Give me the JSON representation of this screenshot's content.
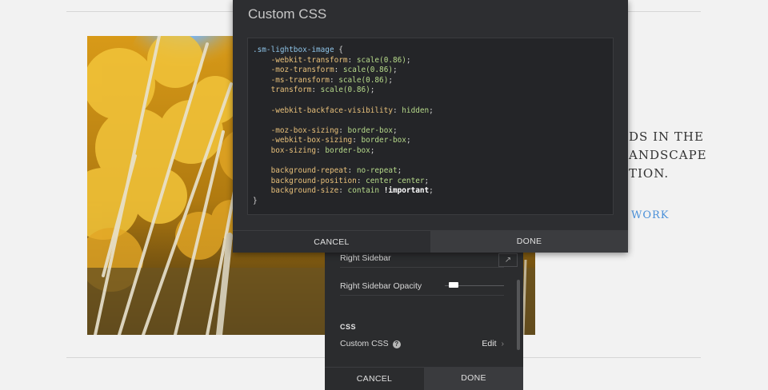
{
  "background_page": {
    "text_lines": [
      "DS IN THE",
      "ANDSCAPE",
      "TION."
    ],
    "link": "WORK"
  },
  "modal": {
    "title": "Custom CSS",
    "css_lines": [
      [
        {
          "t": ".sm-lightbox-image",
          "c": "sel"
        },
        {
          "t": " {",
          "c": ""
        }
      ],
      [
        {
          "t": "    -webkit-transform",
          "c": "prop"
        },
        {
          "t": ": ",
          "c": ""
        },
        {
          "t": "scale(0.86)",
          "c": "val"
        },
        {
          "t": ";",
          "c": ""
        }
      ],
      [
        {
          "t": "    -moz-transform",
          "c": "prop"
        },
        {
          "t": ": ",
          "c": ""
        },
        {
          "t": "scale(0.86)",
          "c": "val"
        },
        {
          "t": ";",
          "c": ""
        }
      ],
      [
        {
          "t": "    -ms-transform",
          "c": "prop"
        },
        {
          "t": ": ",
          "c": ""
        },
        {
          "t": "scale(0.86)",
          "c": "val"
        },
        {
          "t": ";",
          "c": ""
        }
      ],
      [
        {
          "t": "    transform",
          "c": "prop"
        },
        {
          "t": ": ",
          "c": ""
        },
        {
          "t": "scale(0.86)",
          "c": "val"
        },
        {
          "t": ";",
          "c": ""
        }
      ],
      [
        {
          "t": "",
          "c": ""
        }
      ],
      [
        {
          "t": "    -webkit-backface-visibility",
          "c": "prop"
        },
        {
          "t": ": ",
          "c": ""
        },
        {
          "t": "hidden",
          "c": "val"
        },
        {
          "t": ";",
          "c": ""
        }
      ],
      [
        {
          "t": "",
          "c": ""
        }
      ],
      [
        {
          "t": "    -moz-box-sizing",
          "c": "prop"
        },
        {
          "t": ": ",
          "c": ""
        },
        {
          "t": "border-box",
          "c": "val"
        },
        {
          "t": ";",
          "c": ""
        }
      ],
      [
        {
          "t": "    -webkit-box-sizing",
          "c": "prop"
        },
        {
          "t": ": ",
          "c": ""
        },
        {
          "t": "border-box",
          "c": "val"
        },
        {
          "t": ";",
          "c": ""
        }
      ],
      [
        {
          "t": "    box-sizing",
          "c": "prop"
        },
        {
          "t": ": ",
          "c": ""
        },
        {
          "t": "border-box",
          "c": "val"
        },
        {
          "t": ";",
          "c": ""
        }
      ],
      [
        {
          "t": "",
          "c": ""
        }
      ],
      [
        {
          "t": "    background-repeat",
          "c": "prop"
        },
        {
          "t": ": ",
          "c": ""
        },
        {
          "t": "no-repeat",
          "c": "val"
        },
        {
          "t": ";",
          "c": ""
        }
      ],
      [
        {
          "t": "    background-position",
          "c": "prop"
        },
        {
          "t": ": ",
          "c": ""
        },
        {
          "t": "center center",
          "c": "val"
        },
        {
          "t": ";",
          "c": ""
        }
      ],
      [
        {
          "t": "    background-size",
          "c": "prop"
        },
        {
          "t": ": ",
          "c": ""
        },
        {
          "t": "contain ",
          "c": "val"
        },
        {
          "t": "!important",
          "c": "imp"
        },
        {
          "t": ";",
          "c": ""
        }
      ],
      [
        {
          "t": "}",
          "c": ""
        }
      ]
    ],
    "cancel_label": "CANCEL",
    "done_label": "DONE"
  },
  "panel": {
    "right_sidebar_label": "Right Sidebar",
    "eyedropper_icon": "eyedropper-icon",
    "opacity_label": "Right Sidebar Opacity",
    "opacity_value": 0.08,
    "section_heading": "CSS",
    "custom_css_label": "Custom CSS",
    "help_icon": "help-icon",
    "edit_label": "Edit",
    "chevron_icon": "chevron-right-icon",
    "cancel_label": "CANCEL",
    "done_label": "DONE"
  },
  "colors": {
    "modal_bg": "#2d2e31",
    "code_bg": "#242528",
    "selector": "#8ec4e8",
    "property": "#e8c07a",
    "value": "#b6d98a",
    "link": "#4a90d9"
  }
}
